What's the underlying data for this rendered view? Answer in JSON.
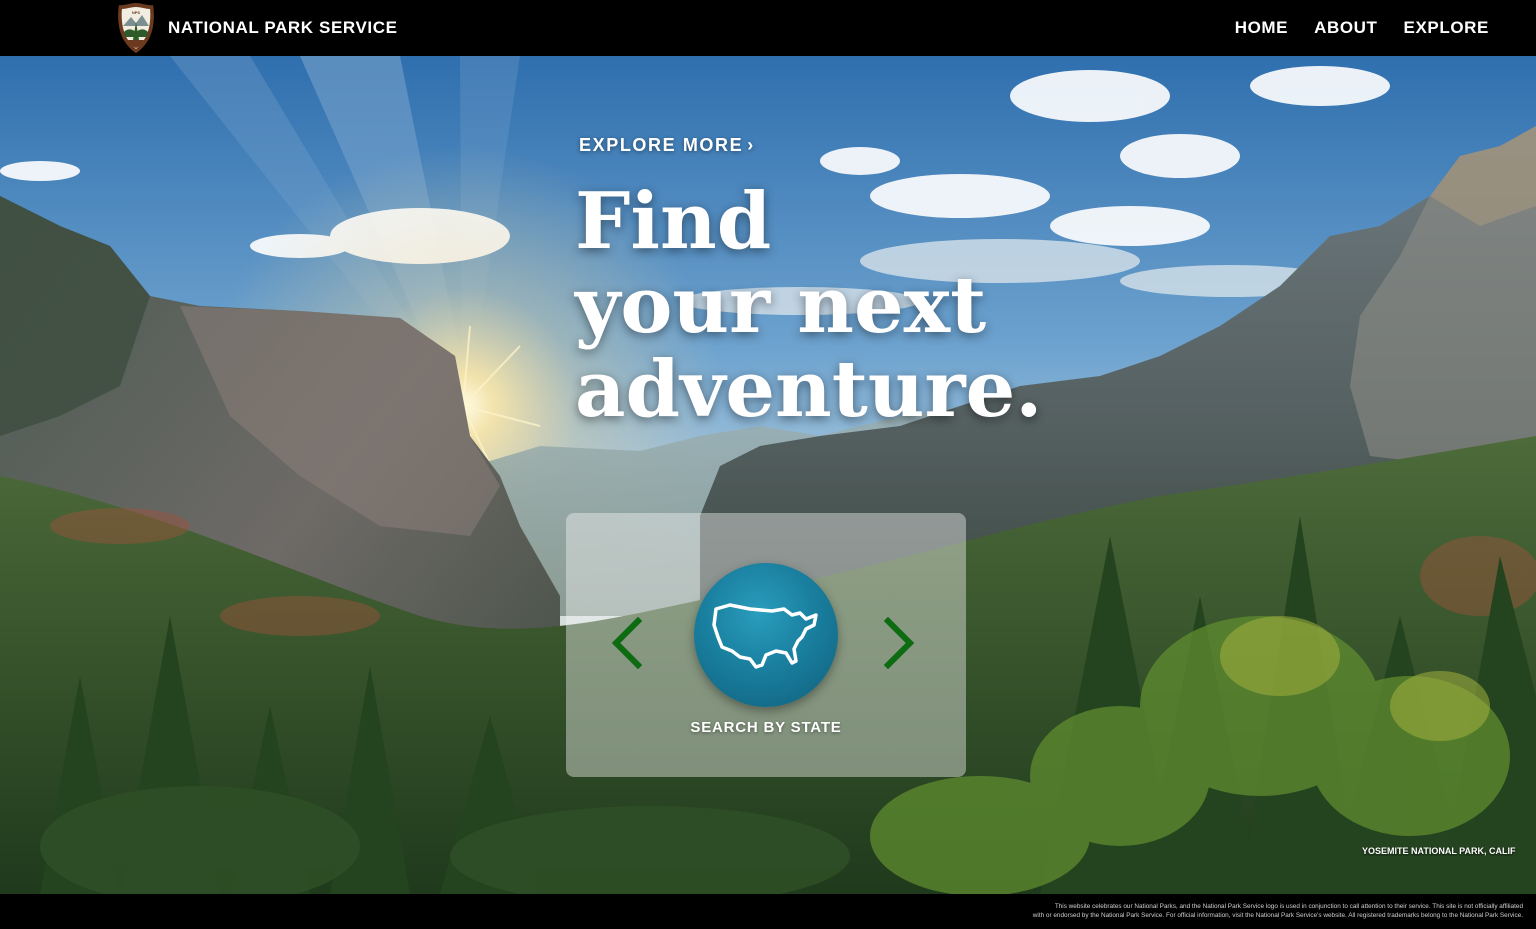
{
  "header": {
    "brand_name": "NATIONAL PARK SERVICE",
    "logo_icon": "nps-arrowhead-logo",
    "nav": [
      {
        "label": "HOME"
      },
      {
        "label": "ABOUT"
      },
      {
        "label": "EXPLORE"
      }
    ]
  },
  "hero": {
    "explore_more": "EXPLORE MORE",
    "headline_lines": [
      "Find",
      "your next",
      "adventure."
    ],
    "caption": "YOSEMITE NATIONAL PARK, CALIF"
  },
  "search_card": {
    "label": "SEARCH BY STATE",
    "prev_icon": "chevron-left-icon",
    "next_icon": "chevron-right-icon",
    "button_icon": "us-map-icon",
    "arrow_color": "#0d6b12",
    "button_color": "#1a7f9f"
  },
  "footer": {
    "line1": "This website celebrates our National Parks, and the National Park Service logo is used in conjunction to call attention to their service. This site is not officially affiliated",
    "line2": "with or endorsed by the National Park Service. For official information, visit the National Park Service's website. All registered trademarks belong to the National Park Service."
  }
}
